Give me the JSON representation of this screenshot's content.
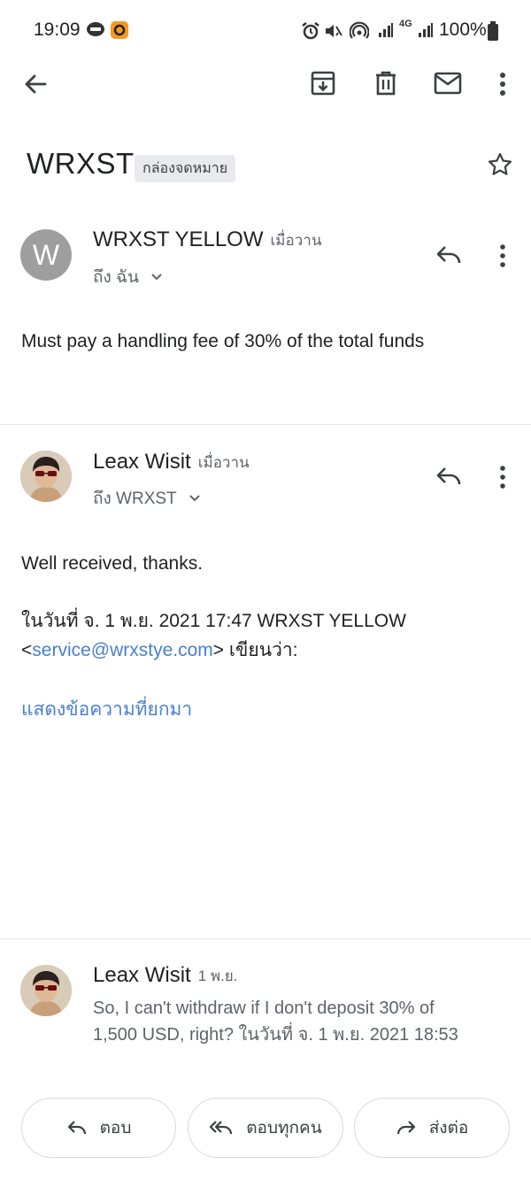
{
  "status_bar": {
    "time": "19:09",
    "network": "4G",
    "battery": "100%"
  },
  "thread": {
    "subject": "WRXST",
    "label": "กล่องจดหมาย"
  },
  "messages": [
    {
      "avatar_letter": "W",
      "sender": "WRXST YELLOW",
      "time": "เมื่อวาน",
      "recipient": "ถึง ฉัน",
      "body": "Must pay a handling fee of 30% of the total funds"
    },
    {
      "sender": "Leax Wisit",
      "time": "เมื่อวาน",
      "recipient": "ถึง WRXST",
      "body": "Well received, thanks.",
      "quote_header_line1": "ในวันที่ จ. 1 พ.ย. 2021 17:47 WRXST YELLOW",
      "quote_open": "<",
      "quote_email": "service@wrxstye.com",
      "quote_close": "> เขียนว่า:",
      "show_quoted": "แสดงข้อความที่ยกมา"
    },
    {
      "sender": "Leax Wisit",
      "time": "1 พ.ย.",
      "snippet_line1": "So, I can't withdraw if I don't deposit 30% of",
      "snippet_line2": "1,500 USD, right? ในวันที่ จ. 1 พ.ย. 2021 18:53"
    }
  ],
  "actions": {
    "reply": "ตอบ",
    "reply_all": "ตอบทุกคน",
    "forward": "ส่งต่อ"
  },
  "colors": {
    "link": "#4a7fd1",
    "avatar_gray": "#9e9e9e"
  }
}
